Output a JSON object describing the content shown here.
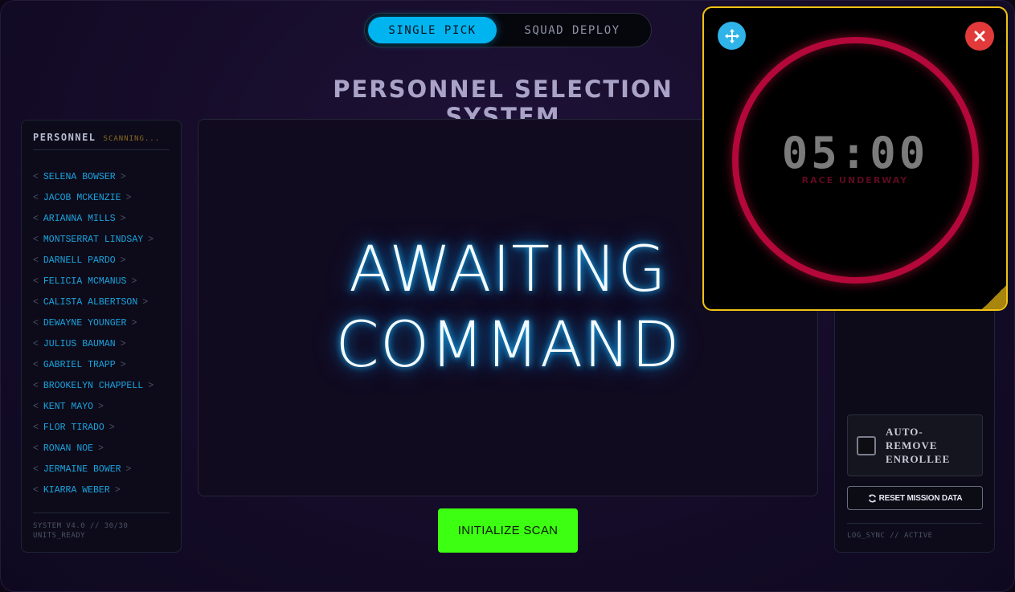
{
  "mode_toggle": {
    "single": "SINGLE PICK",
    "squad": "SQUAD DEPLOY"
  },
  "page_title": "PERSONNEL SELECTION SYSTEM",
  "left_panel": {
    "title": "PERSONNEL",
    "status": "SCANNING...",
    "roster": [
      "SELENA BOWSER",
      "JACOB MCKENZIE",
      "ARIANNA MILLS",
      "MONTSERRAT LINDSAY",
      "DARNELL PARDO",
      "FELICIA MCMANUS",
      "CALISTA ALBERTSON",
      "DEWAYNE YOUNGER",
      "JULIUS BAUMAN",
      "GABRIEL TRAPP",
      "BROOKELYN CHAPPELL",
      "KENT MAYO",
      "FLOR TIRADO",
      "RONAN NOE",
      "JERMAINE BOWER",
      "KIARRA WEBER"
    ],
    "footer": "SYSTEM V4.0 // 30/30 UNITS_READY"
  },
  "center": {
    "line1": "AWAITING",
    "line2": "COMMAND"
  },
  "init_button": "INITIALIZE SCAN",
  "right_panel": {
    "auto_remove_label": "AUTO-REMOVE ENROLLEE",
    "reset_button": "RESET MISSION DATA",
    "footer": "LOG_SYNC // ACTIVE"
  },
  "timer": {
    "time": "05:00",
    "status": "RACE UNDERWAY"
  },
  "colors": {
    "accent_blue": "#00b4f0",
    "init_green": "#3cff12",
    "timer_ring": "#b4083a",
    "widget_border": "#f2c313",
    "close_red": "#e23a3a"
  },
  "icons": {
    "move": "move-arrows-icon",
    "close": "close-x-icon",
    "reset": "refresh-icon"
  }
}
